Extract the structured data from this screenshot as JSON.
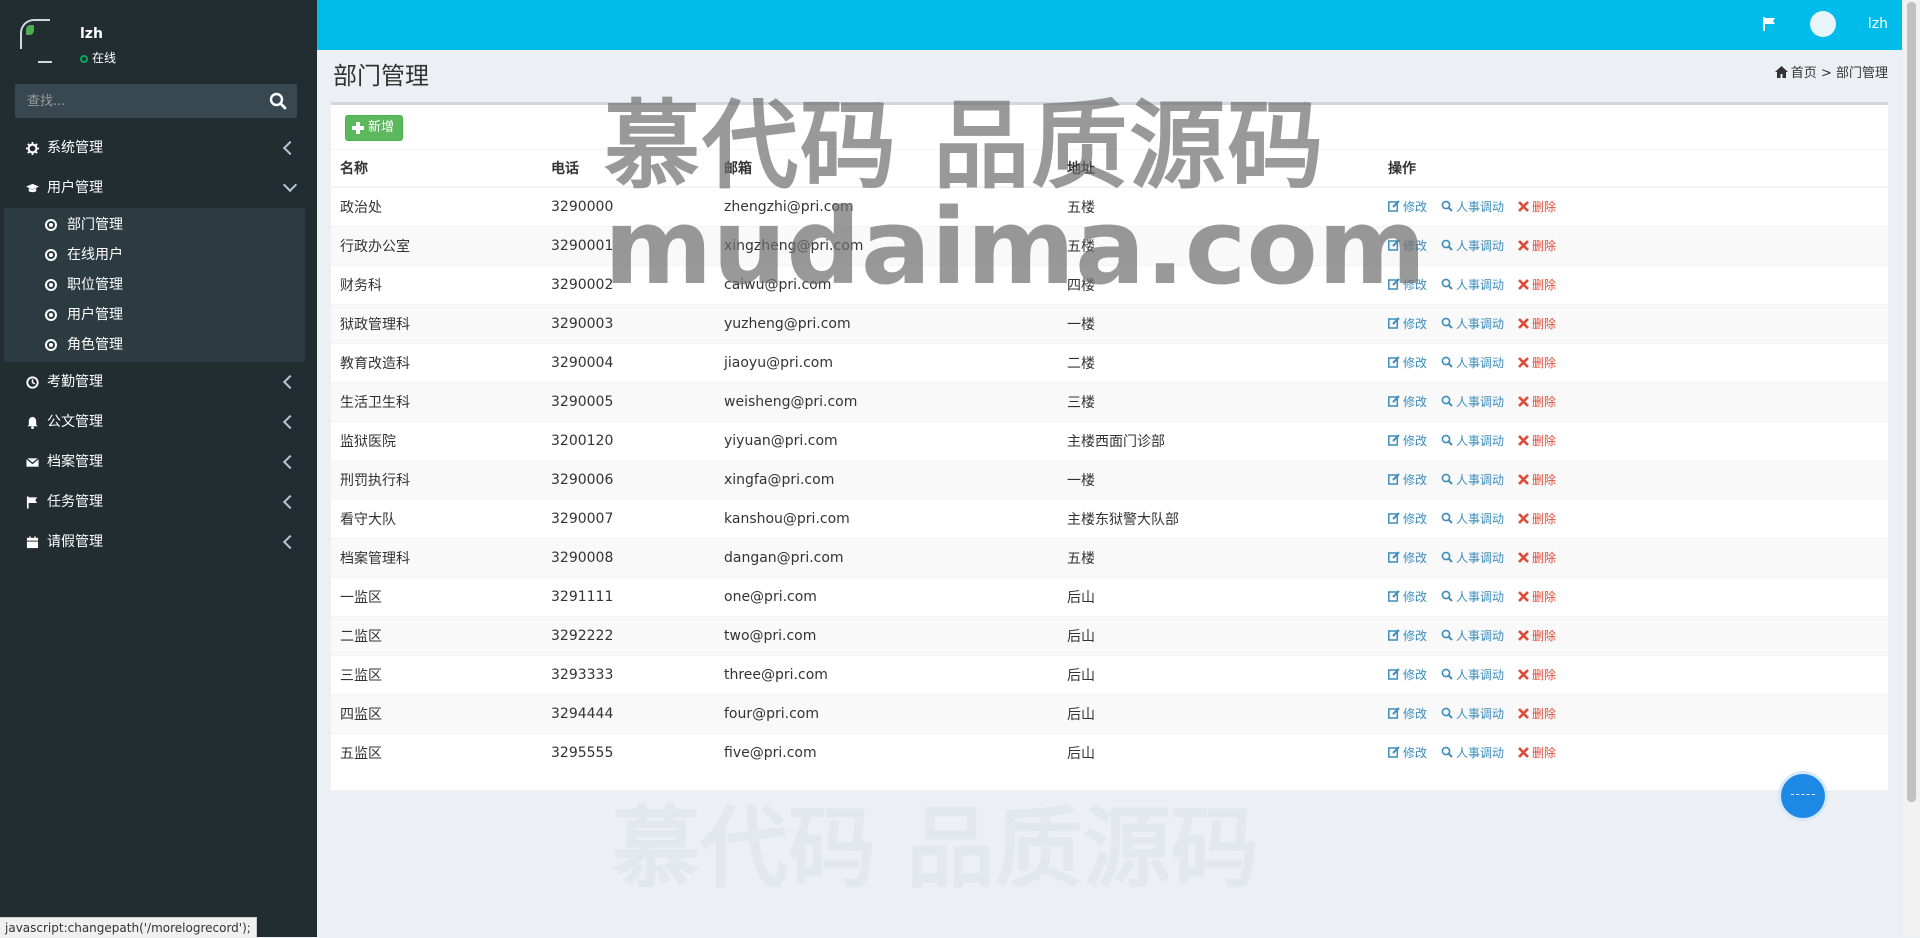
{
  "sidebar": {
    "user_name": "lzh",
    "user_status": "在线",
    "search_placeholder": "查找...",
    "menu": [
      {
        "label": "系统管理",
        "icon": "gear-icon"
      },
      {
        "label": "用户管理",
        "icon": "graduation-cap-icon",
        "expanded": true,
        "children": [
          "部门管理",
          "在线用户",
          "职位管理",
          "用户管理",
          "角色管理"
        ]
      },
      {
        "label": "考勤管理",
        "icon": "clock-icon"
      },
      {
        "label": "公文管理",
        "icon": "bell-icon"
      },
      {
        "label": "档案管理",
        "icon": "envelope-icon"
      },
      {
        "label": "任务管理",
        "icon": "flag-icon"
      },
      {
        "label": "请假管理",
        "icon": "calendar-icon"
      }
    ],
    "status_url": "javascript:changepath('/morelogrecord');"
  },
  "header": {
    "user_name": "lzh"
  },
  "page": {
    "title": "部门管理",
    "breadcrumb_home": "首页",
    "breadcrumb_sep": ">",
    "breadcrumb_current": "部门管理"
  },
  "toolbar": {
    "add_label": "新增"
  },
  "table": {
    "columns": [
      "名称",
      "电话",
      "邮箱",
      "地址",
      "操作"
    ],
    "actions": {
      "edit": "修改",
      "transfer": "人事调动",
      "delete": "删除"
    },
    "rows": [
      [
        "政治处",
        "3290000",
        "zhengzhi@pri.com",
        "五楼"
      ],
      [
        "行政办公室",
        "3290001",
        "xingzheng@pri.com",
        "五楼"
      ],
      [
        "财务科",
        "3290002",
        "caiwu@pri.com",
        "四楼"
      ],
      [
        "狱政管理科",
        "3290003",
        "yuzheng@pri.com",
        "一楼"
      ],
      [
        "教育改造科",
        "3290004",
        "jiaoyu@pri.com",
        "二楼"
      ],
      [
        "生活卫生科",
        "3290005",
        "weisheng@pri.com",
        "三楼"
      ],
      [
        "监狱医院",
        "3200120",
        "yiyuan@pri.com",
        "主楼西面门诊部"
      ],
      [
        "刑罚执行科",
        "3290006",
        "xingfa@pri.com",
        "一楼"
      ],
      [
        "看守大队",
        "3290007",
        "kanshou@pri.com",
        "主楼东狱警大队部"
      ],
      [
        "档案管理科",
        "3290008",
        "dangan@pri.com",
        "五楼"
      ],
      [
        "一监区",
        "3291111",
        "one@pri.com",
        "后山"
      ],
      [
        "二监区",
        "3292222",
        "two@pri.com",
        "后山"
      ],
      [
        "三监区",
        "3293333",
        "three@pri.com",
        "后山"
      ],
      [
        "四监区",
        "3294444",
        "four@pri.com",
        "后山"
      ],
      [
        "五监区",
        "3295555",
        "five@pri.com",
        "后山"
      ]
    ]
  },
  "watermark": {
    "line1": "慕代码 品质源码",
    "line2": "mudaima.com"
  },
  "colors": {
    "topbar": "#00bcea",
    "sidebar": "#222d32",
    "add_button": "#5cb85c",
    "link": "#3c8dbc",
    "danger": "#dd4b39"
  }
}
